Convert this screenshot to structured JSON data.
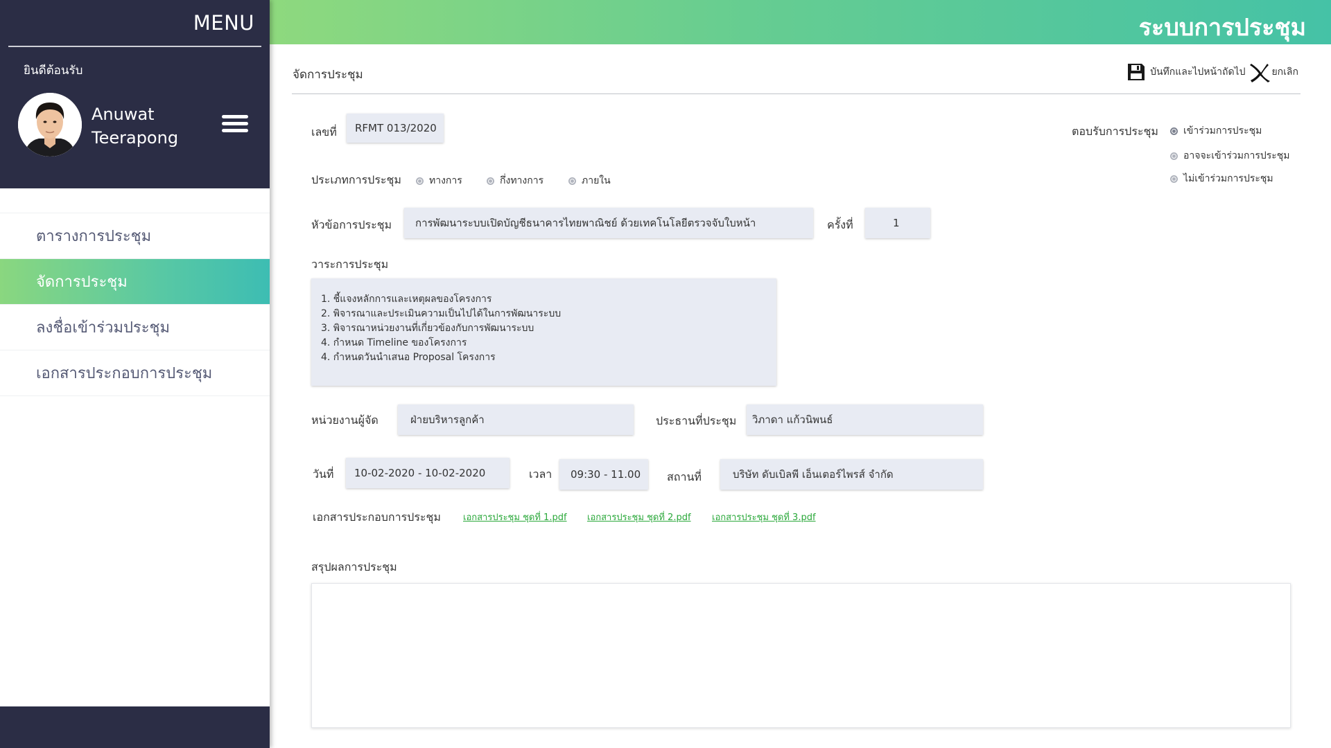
{
  "sidebar": {
    "menu_title": "MENU",
    "welcome": "ยินดีต้อนรับ",
    "user_first": "Anuwat",
    "user_last": "Teerapong",
    "items": [
      {
        "label": "ตารางการประชุม",
        "active": false
      },
      {
        "label": "จัดการประชุม",
        "active": true
      },
      {
        "label": "ลงชื่อเข้าร่วมประชุม",
        "active": false
      },
      {
        "label": "เอกสารประกอบการประชุม",
        "active": false
      }
    ]
  },
  "header": {
    "title": "ระบบการประชุม"
  },
  "page": {
    "title": "จัดการประชุม",
    "save_label": "บันทึกและไปหน้าถัดไป",
    "cancel_label": "ยกเลิก"
  },
  "form": {
    "number_label": "เลขที่",
    "number_value": "RFMT 013/2020",
    "response_label": "ตอบรับการประชุม",
    "response_options": [
      "เข้าร่วมการประชุม",
      "อาจจะเข้าร่วมการประชุม",
      "ไม่เข้าร่วมการประชุม"
    ],
    "response_selected": "เข้าร่วมการประชุม",
    "type_label": "ประเภทการประชุม",
    "type_options": [
      "ทางการ",
      "กึ่งทางการ",
      "ภายใน"
    ],
    "topic_label": "หัวข้อการประชุม",
    "topic_value": "การพัฒนาระบบเปิดบัญชีธนาคารไทยพาณิชย์ ด้วยเทคโนโลยีตรวจจับใบหน้า",
    "round_label": "ครั้งที่",
    "round_value": "1",
    "agenda_label": "วาระการประชุม",
    "agenda_items": [
      "1. ชี้แจงหลักการและเหตุผลของโครงการ",
      "2. พิจารณาและประเมินความเป็นไปได้ในการพัฒนาระบบ",
      "3. พิจารณาหน่วยงานที่เกี่ยวข้องกับการพัฒนาระบบ",
      "4. กำหนด Timeline ของโครงการ",
      "4. กำหนดวันนำเสนอ Proposal โครงการ"
    ],
    "organizer_label": "หน่วยงานผู้จัด",
    "organizer_value": "ฝ่ายบริหารลูกค้า",
    "chair_label": "ประธานที่ประชุม",
    "chair_value": "วิภาดา แก้วนิพนธ์",
    "date_label": "วันที่",
    "date_value": "10-02-2020 - 10-02-2020",
    "time_label": "เวลา",
    "time_value": "09:30 - 11.00",
    "place_label": "สถานที่",
    "place_value": "บริษัท ดับเบิลพี เอ็นเตอร์ไพรส์ จำกัด",
    "docs_label": "เอกสารประกอบการประชุม",
    "docs": [
      "เอกสารประชุม ชุดที่ 1.pdf",
      "เอกสารประชุม ชุดที่ 2.pdf",
      "เอกสารประชุม ชุดที่ 3.pdf"
    ],
    "summary_label": "สรุปผลการประชุม",
    "summary_value": ""
  },
  "colors": {
    "sidebar_dark": "#2b2d45",
    "accent_green": "#8ed97e",
    "accent_teal": "#45c2a6",
    "field_bg": "#e8ebf3",
    "link_green": "#2aa83a"
  }
}
